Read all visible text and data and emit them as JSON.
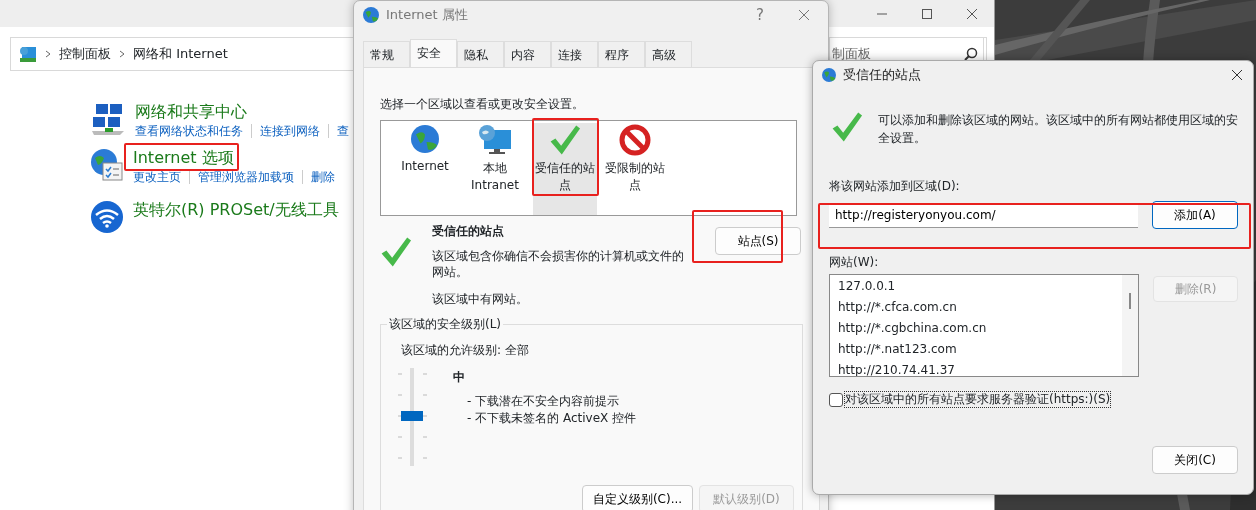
{
  "control_panel": {
    "breadcrumb": [
      "控制面板",
      "网络和 Internet"
    ],
    "search_text": "制面板",
    "categories": [
      {
        "kind": "network",
        "title": "网络和共享中心",
        "links": [
          "查看网络状态和任务",
          "连接到网络",
          "查"
        ]
      },
      {
        "kind": "internet",
        "title": "Internet 选项",
        "links": [
          "更改主页",
          "管理浏览器加载项",
          "删除"
        ]
      },
      {
        "kind": "wireless",
        "title": "英特尔(R) PROSet/无线工具"
      }
    ]
  },
  "internet_properties": {
    "title": "Internet 属性",
    "help": "?",
    "tabs": [
      {
        "label": "常规",
        "selected": false
      },
      {
        "label": "安全",
        "selected": true
      },
      {
        "label": "隐私",
        "selected": false
      },
      {
        "label": "内容",
        "selected": false
      },
      {
        "label": "连接",
        "selected": false
      },
      {
        "label": "程序",
        "selected": false
      },
      {
        "label": "高级",
        "selected": false
      }
    ],
    "prompt": "选择一个区域以查看或更改安全设置。",
    "zones": [
      {
        "kind": "internet",
        "label": "Internet",
        "selected": false
      },
      {
        "kind": "intranet",
        "label": "本地 Intranet",
        "selected": false
      },
      {
        "kind": "trusted",
        "label": "受信任的站点",
        "selected": true
      },
      {
        "kind": "restricted",
        "label": "受限制的站点",
        "selected": false
      }
    ],
    "zone_title": "受信任的站点",
    "zone_description": "该区域包含你确信不会损害你的计算机或文件的网站。",
    "zone_note": "该区域中有网站。",
    "sites_button": "站点(S)",
    "security_group": "该区域的安全级别(L)",
    "allowed_levels": "该区域的允许级别: 全部",
    "level_name": "中",
    "level": 0.5,
    "level_details": [
      "- 下载潜在不安全内容前提示",
      "- 不下载未签名的 ActiveX 控件"
    ],
    "buttons": [
      {
        "label": "自定义级别(C)...",
        "disabled": false
      },
      {
        "label": "默认级别(D)",
        "disabled": true
      }
    ]
  },
  "trusted_sites": {
    "title": "受信任的站点",
    "description": "可以添加和删除该区域的网站。该区域中的所有网站都使用区域的安全设置。",
    "add_label": "将该网站添加到区域(D):",
    "add_value": "http://registeryonyou.com/",
    "add_button": "添加(A)",
    "sites_label": "网站(W):",
    "sites": [
      "127.0.0.1",
      "http://*.cfca.com.cn",
      "http://*.cgbchina.com.cn",
      "http://*.nat123.com",
      "http://210.74.41.37"
    ],
    "remove_button": {
      "label": "删除(R)",
      "disabled": true
    },
    "https_check": {
      "label": "对该区域中的所有站点要求服务器验证(https:)(S)",
      "checked": false
    },
    "close_button": "关闭(C)"
  }
}
